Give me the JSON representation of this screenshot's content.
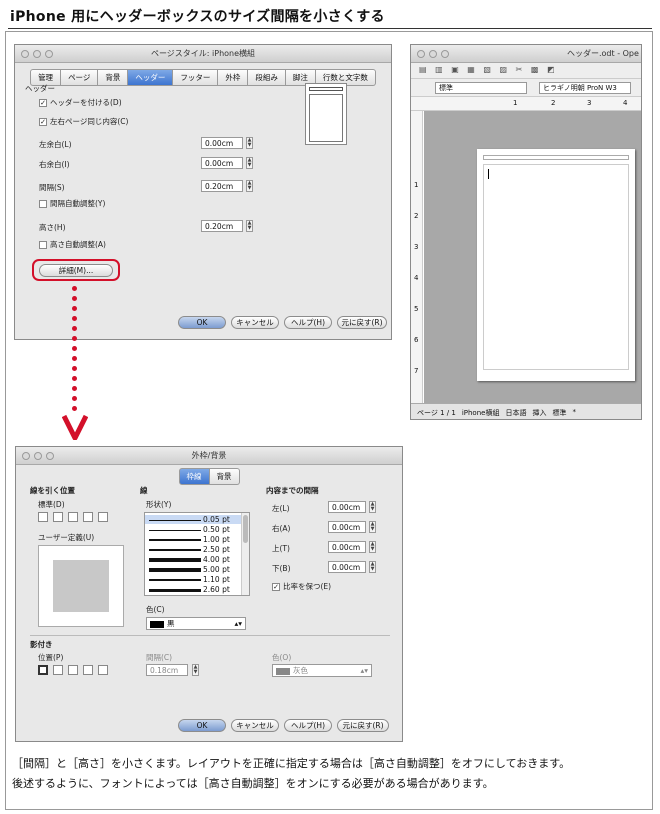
{
  "heading": "iPhone 用にヘッダーボックスのサイズ間隔を小さくする",
  "dialog1": {
    "title": "ページスタイル: iPhone横組",
    "tabs": [
      "管理",
      "ページ",
      "背景",
      "ヘッダー",
      "フッター",
      "外枠",
      "段組み",
      "脚注",
      "行数と文字数"
    ],
    "section": "ヘッダー",
    "header_on": "ヘッダーを付ける(D)",
    "same_lr": "左右ページ同じ内容(C)",
    "left_margin": {
      "label": "左余白(L)",
      "value": "0.00cm"
    },
    "right_margin": {
      "label": "右余白(I)",
      "value": "0.00cm"
    },
    "spacing": {
      "label": "間隔(S)",
      "value": "0.20cm"
    },
    "spacing_auto": "間隔自動調整(Y)",
    "height": {
      "label": "高さ(H)",
      "value": "0.20cm"
    },
    "height_auto": "高さ自動調整(A)",
    "more_button": "詳細(M)...",
    "ok": "OK",
    "cancel": "キャンセル",
    "help": "ヘルプ(H)",
    "reset": "元に戻す(R)"
  },
  "writer": {
    "title": "ヘッダー.odt - Ope",
    "style": "標準",
    "font": "ヒラギノ明朝 ProN W3",
    "ruler": [
      "1",
      "2",
      "3",
      "4"
    ],
    "vruler": [
      "1",
      "2",
      "3",
      "4",
      "5",
      "6",
      "7"
    ],
    "status": [
      "ページ 1 / 1",
      "iPhone横組",
      "日本語",
      "挿入",
      "標準",
      "*"
    ]
  },
  "dialog2": {
    "title": "外枠/背景",
    "tabs": [
      "枠線",
      "背景"
    ],
    "line_position": "線を引く位置",
    "default_label": "標準(D)",
    "user_defined": "ユーザー定義(U)",
    "line": "線",
    "style_label": "形状(Y)",
    "styles": [
      "0.05 pt",
      "0.50 pt",
      "1.00 pt",
      "2.50 pt",
      "4.00 pt",
      "5.00 pt",
      "1.10 pt",
      "2.60 pt"
    ],
    "style_weights": [
      0.5,
      1,
      1.5,
      2.5,
      3.5,
      4.5,
      2,
      3
    ],
    "color_label": "色(C)",
    "color_value": "黒",
    "padding_title": "内容までの間隔",
    "left": {
      "label": "左(L)",
      "value": "0.00cm"
    },
    "right": {
      "label": "右(A)",
      "value": "0.00cm"
    },
    "top": {
      "label": "上(T)",
      "value": "0.00cm"
    },
    "bottom": {
      "label": "下(B)",
      "value": "0.00cm"
    },
    "keep_ratio": "比率を保つ(E)",
    "shadow_title": "影付き",
    "position_label": "位置(P)",
    "distance_label": "間隔(C)",
    "distance_value": "0.18cm",
    "shadow_color_label": "色(O)",
    "shadow_color_value": "灰色",
    "ok": "OK",
    "cancel": "キャンセル",
    "help": "ヘルプ(H)",
    "reset": "元に戻す(R)"
  },
  "caption": {
    "line1": "［間隔］と［高さ］を小さくます。レイアウトを正確に指定する場合は［高さ自動調整］をオフにしておきます。",
    "line2": "後述するように、フォントによっては［高さ自動調整］をオンにする必要がある場合があります。"
  },
  "colors": {
    "highlight": "#d3102a",
    "selected_tab": "#3d74d0"
  }
}
